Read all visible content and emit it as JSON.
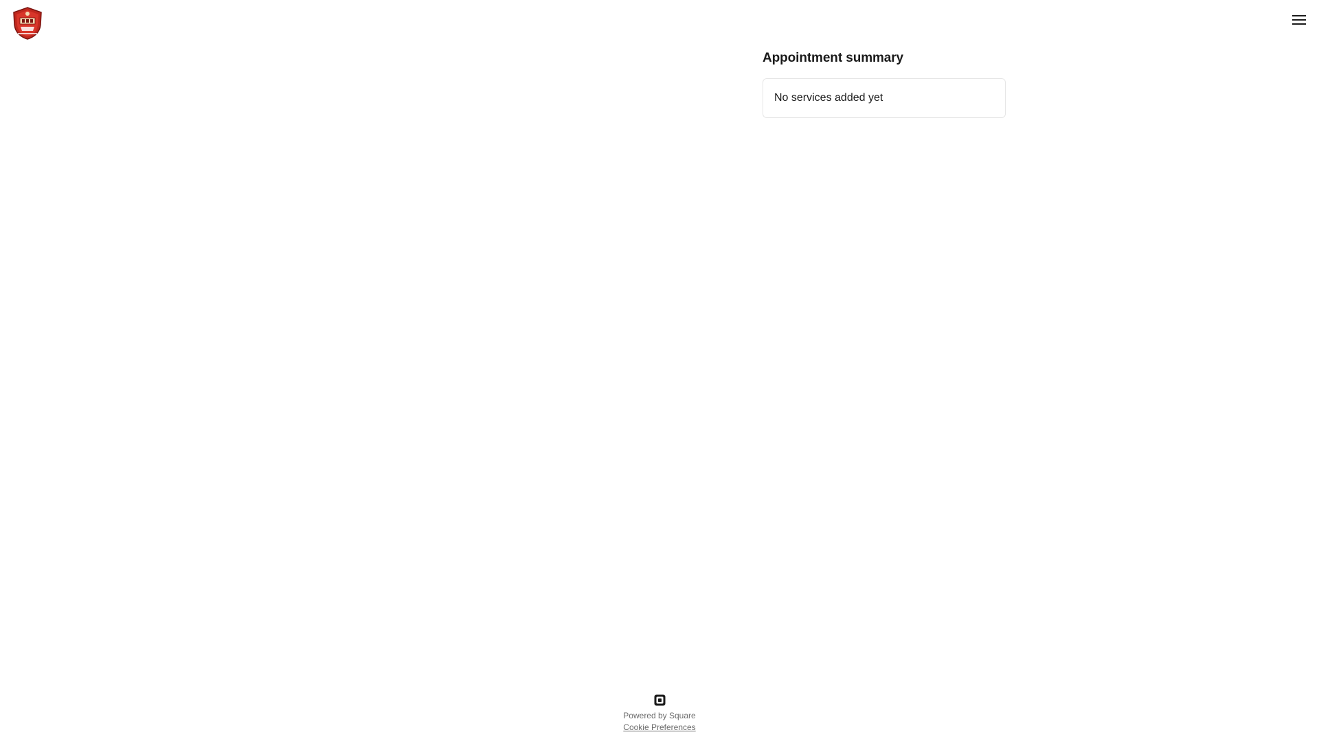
{
  "header": {
    "logo_icon": "shield-crest-logo-icon",
    "menu_icon": "hamburger-menu-icon"
  },
  "summary": {
    "title": "Appointment summary",
    "empty_message": "No services added yet"
  },
  "footer": {
    "square_icon": "square-logo-icon",
    "powered_by": "Powered by Square",
    "cookie_preferences": "Cookie Preferences"
  },
  "colors": {
    "text_primary": "#1a1a1a",
    "text_secondary": "#6b6b6b",
    "card_border": "#e6e6e6",
    "logo_red": "#c0281e"
  }
}
